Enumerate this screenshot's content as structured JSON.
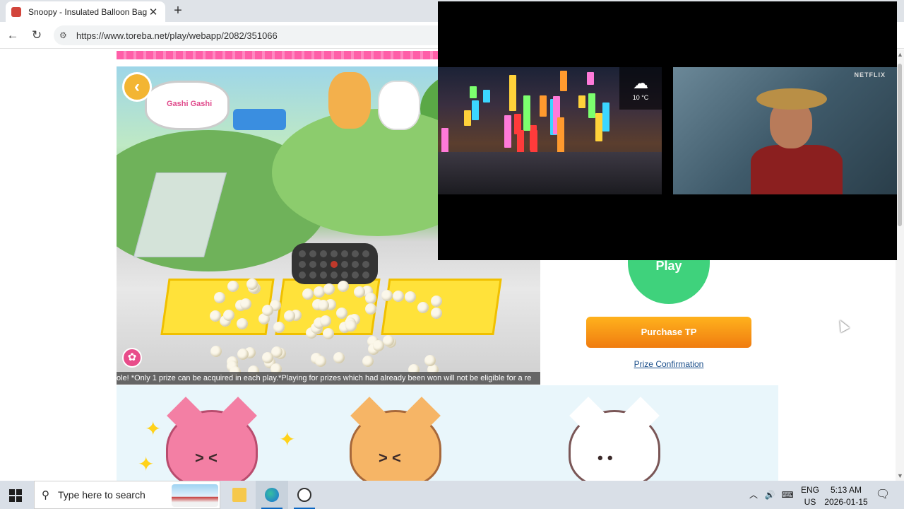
{
  "browser": {
    "tab_title": "Snoopy - Insulated Balloon Bag S",
    "tab_close": "✕",
    "new_tab": "+",
    "url": "https://www.toreba.net/play/webapp/2082/351066"
  },
  "game": {
    "stand_text": "Gashi Gashi",
    "ticker_text": "ole! *Only 1 prize can be acquired in each play.*Playing for prizes which had already been won will not be eligible for a re"
  },
  "panel": {
    "play_label": "Play",
    "purchase_label": "Purchase TP",
    "prize_link": "Prize Confirmation"
  },
  "overlay": {
    "weather_temp": "10 °C",
    "netflix_label": "NETFLIX"
  },
  "taskbar": {
    "search_placeholder": "Type here to search",
    "lang_top": "ENG",
    "lang_bottom": "US",
    "time": "5:13 AM",
    "date": "2026-01-15"
  }
}
